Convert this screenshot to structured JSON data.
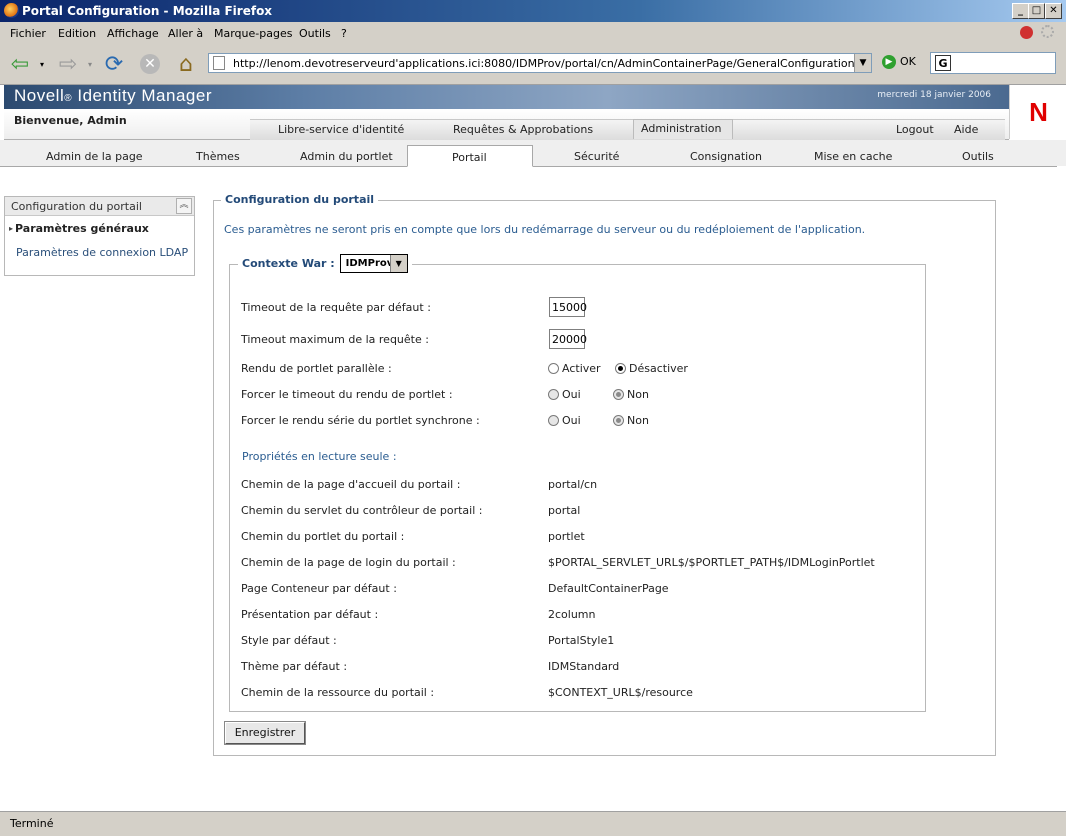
{
  "window": {
    "title": "Portal Configuration - Mozilla Firefox"
  },
  "menu": [
    "Fichier",
    "Edition",
    "Affichage",
    "Aller à",
    "Marque-pages",
    "Outils",
    "?"
  ],
  "browser": {
    "url": "http://lenom.devotreserveurd'applications.ici:8080/IDMProv/portal/cn/AdminContainerPage/GeneralConfiguration",
    "go_label": "OK",
    "status": "Terminé"
  },
  "header": {
    "brand": "Novell",
    "brand_mark": "®",
    "product": "Identity Manager",
    "date": "mercredi 18 janvier 2006",
    "logo_letter": "N",
    "welcome": "Bienvenue, Admin",
    "top_tabs": [
      "Libre-service d'identité",
      "Requêtes & Approbations",
      "Administration"
    ],
    "logout": "Logout",
    "help": "Aide"
  },
  "subtabs": [
    "Admin de la page",
    "Thèmes",
    "Admin du portlet",
    "Portail",
    "Sécurité",
    "Consignation",
    "Mise en cache",
    "Outils"
  ],
  "sidebar": {
    "title": "Configuration du portail",
    "items": [
      "Paramètres généraux",
      "Paramètres de connexion LDAP"
    ]
  },
  "main": {
    "title": "Configuration du portail",
    "note": "Ces paramètres ne seront pris en compte que lors du redémarrage du serveur ou du redéploiement de l'application.",
    "context_label": "Contexte War :",
    "context_value": "IDMProv",
    "timeout_default_label": "Timeout de la requête par défaut :",
    "timeout_default_value": "15000",
    "timeout_max_label": "Timeout maximum de la requête :",
    "timeout_max_value": "20000",
    "parallel_label": "Rendu de portlet parallèle :",
    "parallel_on": "Activer",
    "parallel_off": "Désactiver",
    "force_timeout_label": "Forcer le timeout du rendu de portlet :",
    "force_serial_label": "Forcer le rendu série du portlet synchrone :",
    "yes": "Oui",
    "no": "Non",
    "readonly_title": "Propriétés en lecture seule :",
    "readonly": [
      {
        "label": "Chemin de la page d'accueil du portail :",
        "value": "portal/cn"
      },
      {
        "label": "Chemin du servlet du contrôleur de portail :",
        "value": "portal"
      },
      {
        "label": "Chemin du portlet du portail :",
        "value": "portlet"
      },
      {
        "label": "Chemin de la page de login du portail :",
        "value": "$PORTAL_SERVLET_URL$/$PORTLET_PATH$/IDMLoginPortlet"
      },
      {
        "label": "Page Conteneur par défaut :",
        "value": "DefaultContainerPage"
      },
      {
        "label": "Présentation par défaut :",
        "value": "2column"
      },
      {
        "label": "Style par défaut :",
        "value": "PortalStyle1"
      },
      {
        "label": "Thème par défaut :",
        "value": "IDMStandard"
      },
      {
        "label": "Chemin de la ressource du portail :",
        "value": "$CONTEXT_URL$/resource"
      }
    ],
    "save": "Enregistrer"
  }
}
